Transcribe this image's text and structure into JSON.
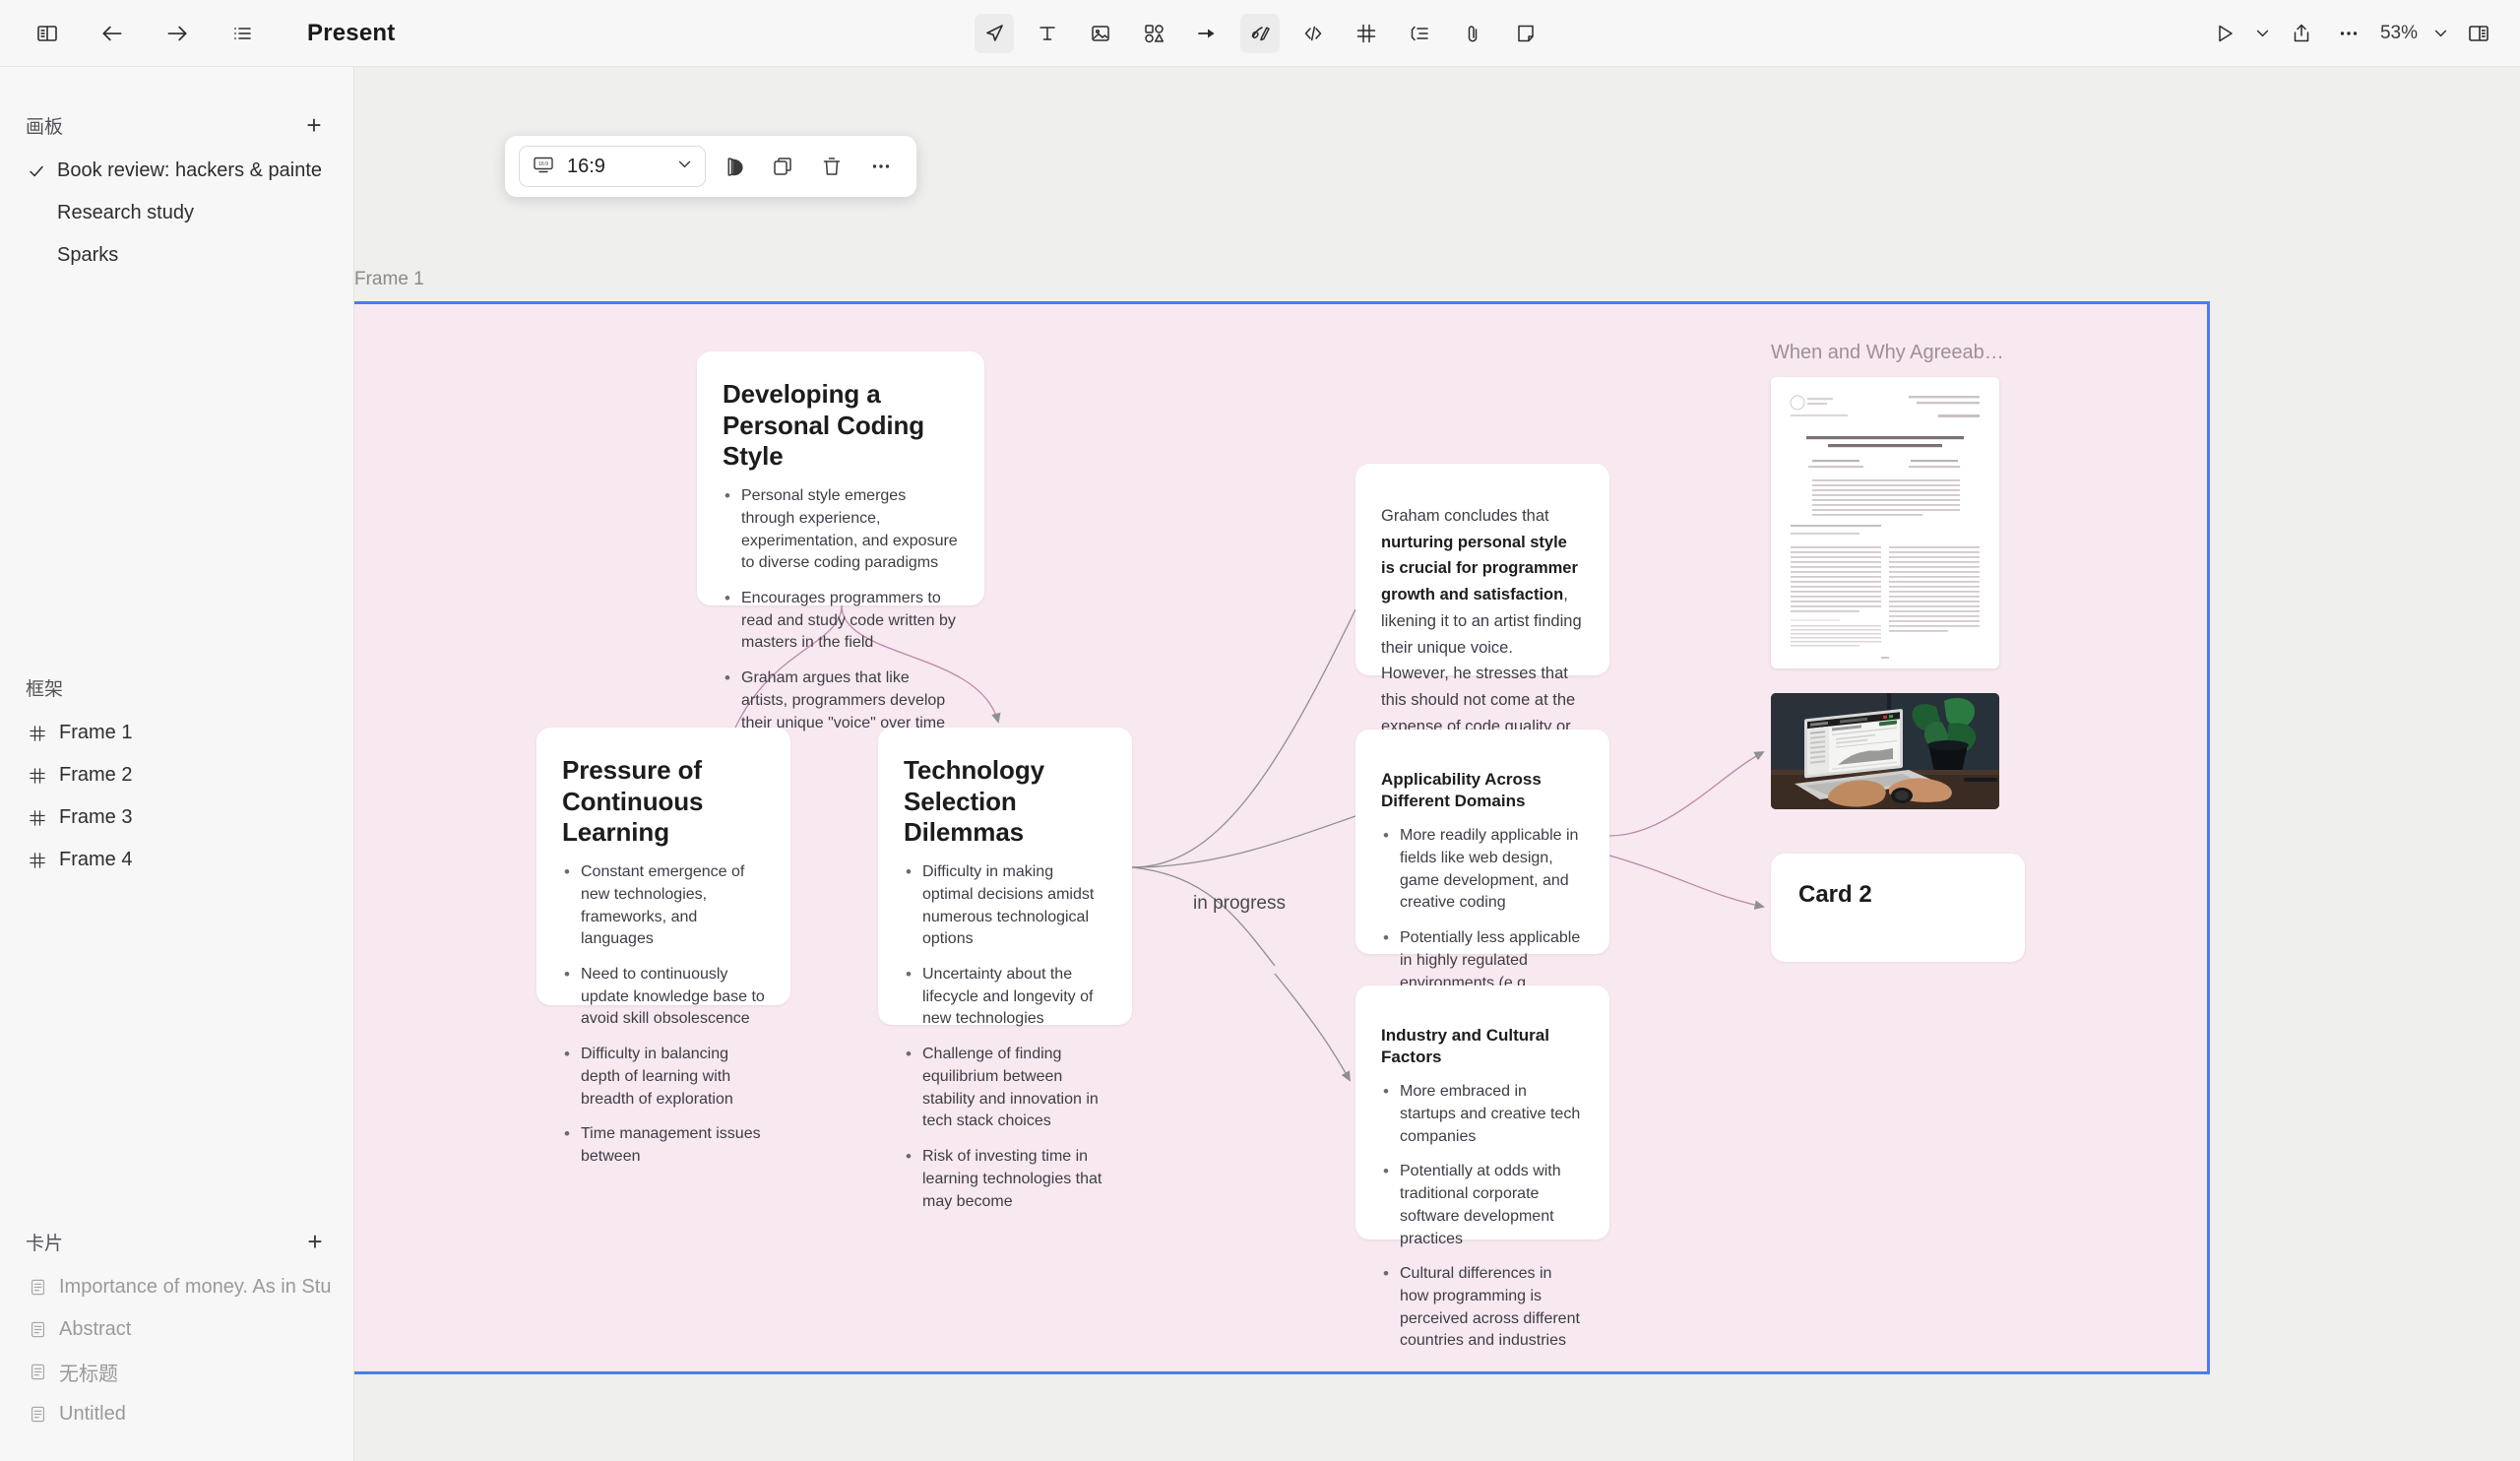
{
  "topbar": {
    "panel_toggle_icon": "panel-left-icon",
    "back_icon": "arrow-left-icon",
    "forward_icon": "arrow-right-icon",
    "outline_icon": "list-icon",
    "title": "Present",
    "tools": [
      {
        "name": "select-tool",
        "icon": "cursor-arrow-icon",
        "active": true
      },
      {
        "name": "text-tool",
        "icon": "text-t-icon",
        "active": false
      },
      {
        "name": "image-tool",
        "icon": "image-icon",
        "active": false
      },
      {
        "name": "shape-tool",
        "icon": "shapes-icon",
        "active": false
      },
      {
        "name": "arrow-tool",
        "icon": "arrow-right-icon",
        "active": false
      },
      {
        "name": "draw-tool",
        "icon": "pen-scribble-icon",
        "active": true
      },
      {
        "name": "code-tool",
        "icon": "code-brackets-icon",
        "active": false
      },
      {
        "name": "frame-tool",
        "icon": "frame-hash-icon",
        "active": false
      },
      {
        "name": "list-tool",
        "icon": "bullet-list-icon",
        "active": false
      },
      {
        "name": "attach-tool",
        "icon": "paperclip-icon",
        "active": false
      },
      {
        "name": "note-tool",
        "icon": "sticky-note-icon",
        "active": false
      }
    ],
    "play_icon": "play-triangle-icon",
    "play_caret_icon": "chevron-down-icon",
    "share_icon": "share-upload-icon",
    "more_icon": "ellipsis-icon",
    "zoom_level": "53%",
    "zoom_caret_icon": "chevron-down-icon",
    "right_panel_icon": "panel-right-icon"
  },
  "sidebar": {
    "boards": {
      "title": "画板",
      "add_icon": "plus-icon",
      "items": [
        {
          "label": "Book review:  hackers & painte",
          "checked": true
        },
        {
          "label": "Research study",
          "checked": false
        },
        {
          "label": "Sparks",
          "checked": false
        }
      ]
    },
    "frames": {
      "title": "框架",
      "items": [
        {
          "label": "Frame 1",
          "icon": "frame-hash-icon"
        },
        {
          "label": "Frame 2",
          "icon": "frame-hash-icon"
        },
        {
          "label": "Frame 3",
          "icon": "frame-hash-icon"
        },
        {
          "label": "Frame 4",
          "icon": "frame-hash-icon"
        }
      ]
    },
    "cards": {
      "title": "卡片",
      "add_icon": "plus-icon",
      "items": [
        {
          "label": "Importance of money. As in Stu",
          "icon": "card-doc-icon"
        },
        {
          "label": "Abstract",
          "icon": "card-doc-icon"
        },
        {
          "label": "无标题",
          "icon": "card-doc-icon"
        },
        {
          "label": "Untitled",
          "icon": "card-doc-icon"
        }
      ]
    }
  },
  "context_toolbar": {
    "ratio_icon": "aspect-ratio-16-9-icon",
    "ratio_value": "16:9",
    "ratio_caret_icon": "chevron-down-icon",
    "style_icon": "palette-icon",
    "duplicate_icon": "copy-icon",
    "delete_icon": "trash-icon",
    "more_icon": "ellipsis-icon"
  },
  "canvas": {
    "frame_label": "Frame 1",
    "frame_background": "#f8e8f0",
    "frame_border_color": "#4a7bf7",
    "edge_label": "in progress",
    "edge_color": "#8f8f8f"
  },
  "cards": {
    "coding_style": {
      "title": "Developing a Personal Coding Style",
      "bullets": [
        "Personal style emerges through experience, experimentation, and exposure to diverse coding paradigms",
        "Encourages programmers to read and study code written by masters in the field",
        "Graham argues that like artists, programmers develop their unique \"voice\" over time"
      ]
    },
    "pressure": {
      "title": "Pressure of Continuous Learning",
      "bullets": [
        "Constant emergence of new technologies, frameworks, and languages",
        "Need to continuously update knowledge base to avoid skill obsolescence",
        "Difficulty in balancing depth of learning with breadth of exploration",
        "Time management issues between"
      ]
    },
    "tech_selection": {
      "title": "Technology Selection Dilemmas",
      "bullets": [
        "Difficulty in making optimal decisions amidst numerous technological options",
        "Uncertainty about the lifecycle and longevity of new technologies",
        "Challenge of finding equilibrium between stability and innovation in tech stack choices",
        "Risk of investing time in learning technologies that may become"
      ]
    },
    "conclusion": {
      "lead": "Graham concludes that ",
      "bold": "nurturing personal style is crucial for programmer growth and satisfaction",
      "tail": ", likening it to an artist finding their unique voice. However, he stresses that this should not come at the expense of code quality or team efficiency."
    },
    "applicability": {
      "title": "Applicability Across Different Domains",
      "bullets": [
        "More readily applicable in fields like web design, game development, and creative coding",
        "Potentially less applicable in highly regulated environments (e.g., financial systems, medical software)"
      ]
    },
    "industry": {
      "title": "Industry and Cultural Factors",
      "bullets": [
        "More embraced in startups and creative tech companies",
        "Potentially at odds with traditional corporate software development practices",
        "Cultural differences in how programming is perceived across different countries and industries"
      ]
    },
    "card2": {
      "title": "Card 2"
    }
  },
  "doc_thumbnail": {
    "title": "When and Why Agreeab…",
    "paper_title": "Nice Guys Finish Last: When and Why Agreeableness Is Associated With Economic Hardship",
    "journal": "Journal of Personality and Social Psychology",
    "journal_sub": "Personality Processes and Individual Differences"
  },
  "photo": {
    "alt": "person typing on laptop with analytics dashboard beside a potted plant"
  }
}
